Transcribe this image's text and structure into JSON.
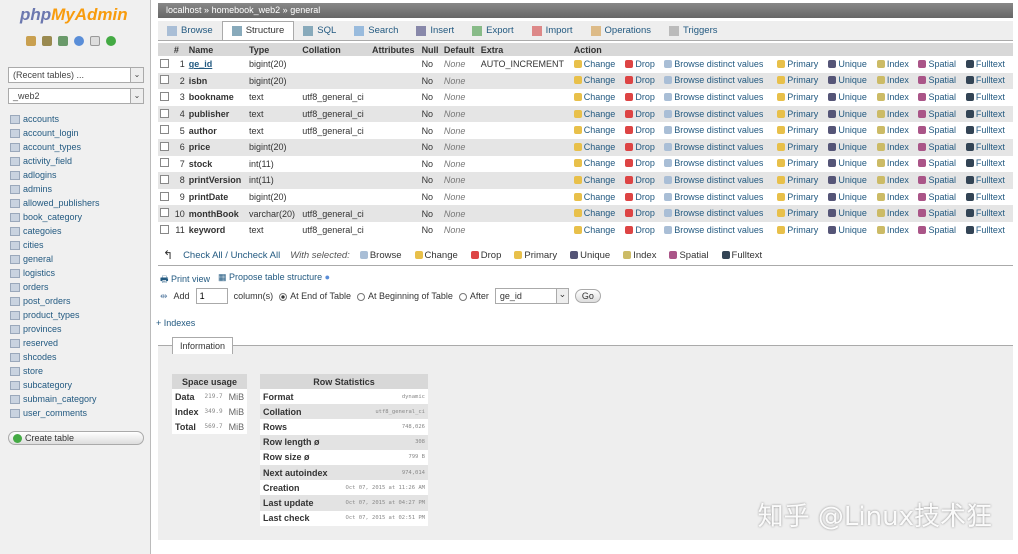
{
  "sidebar": {
    "logo": "phpMyAdmin",
    "logo_php": "php",
    "logo_ma": "MyAdmin",
    "recent_tables": "(Recent tables) ...",
    "database": "_web2",
    "tables": [
      "accounts",
      "account_login",
      "account_types",
      "activity_field",
      "adlogins",
      "admins",
      "allowed_publishers",
      "book_category",
      "categoies",
      "cities",
      "general",
      "logistics",
      "orders",
      "post_orders",
      "product_types",
      "provinces",
      "reserved",
      "shcodes",
      "store",
      "subcategory",
      "submain_category",
      "user_comments"
    ],
    "create_table": "Create table"
  },
  "breadcrumb": {
    "server": "localhost",
    "db": "homebook_web2",
    "table": "general",
    "sep": "»"
  },
  "tabs": [
    "Browse",
    "Structure",
    "SQL",
    "Search",
    "Insert",
    "Export",
    "Import",
    "Operations",
    "Triggers"
  ],
  "active_tab": "Structure",
  "columns_header": [
    "#",
    "Name",
    "Type",
    "Collation",
    "Attributes",
    "Null",
    "Default",
    "Extra",
    "Action"
  ],
  "actions": [
    "Change",
    "Drop",
    "Browse distinct values",
    "Primary",
    "Unique",
    "Index",
    "Spatial",
    "Fulltext"
  ],
  "rows": [
    {
      "n": "1",
      "name": "ge_id",
      "type": "bigint(20)",
      "collation": "",
      "null": "No",
      "default": "None",
      "extra": "AUTO_INCREMENT"
    },
    {
      "n": "2",
      "name": "isbn",
      "type": "bigint(20)",
      "collation": "",
      "null": "No",
      "default": "None",
      "extra": ""
    },
    {
      "n": "3",
      "name": "bookname",
      "type": "text",
      "collation": "utf8_general_ci",
      "null": "No",
      "default": "None",
      "extra": ""
    },
    {
      "n": "4",
      "name": "publisher",
      "type": "text",
      "collation": "utf8_general_ci",
      "null": "No",
      "default": "None",
      "extra": ""
    },
    {
      "n": "5",
      "name": "author",
      "type": "text",
      "collation": "utf8_general_ci",
      "null": "No",
      "default": "None",
      "extra": ""
    },
    {
      "n": "6",
      "name": "price",
      "type": "bigint(20)",
      "collation": "",
      "null": "No",
      "default": "None",
      "extra": ""
    },
    {
      "n": "7",
      "name": "stock",
      "type": "int(11)",
      "collation": "",
      "null": "No",
      "default": "None",
      "extra": ""
    },
    {
      "n": "8",
      "name": "printVersion",
      "type": "int(11)",
      "collation": "",
      "null": "No",
      "default": "None",
      "extra": ""
    },
    {
      "n": "9",
      "name": "printDate",
      "type": "bigint(20)",
      "collation": "",
      "null": "No",
      "default": "None",
      "extra": ""
    },
    {
      "n": "10",
      "name": "monthBook",
      "type": "varchar(20)",
      "collation": "utf8_general_ci",
      "null": "No",
      "default": "None",
      "extra": ""
    },
    {
      "n": "11",
      "name": "keyword",
      "type": "text",
      "collation": "utf8_general_ci",
      "null": "No",
      "default": "None",
      "extra": ""
    }
  ],
  "with_selected": {
    "check_all": "Check All / Uncheck All",
    "label": "With selected:",
    "actions": [
      "Browse",
      "Change",
      "Drop",
      "Primary",
      "Unique",
      "Index",
      "Spatial",
      "Fulltext"
    ]
  },
  "tools": {
    "print_view": "Print view",
    "propose": "Propose table structure"
  },
  "add_column": {
    "label": "Add",
    "count": "1",
    "suffix": "column(s)",
    "at_end": "At End of Table",
    "at_begin": "At Beginning of Table",
    "after": "After",
    "after_value": "ge_id",
    "go": "Go"
  },
  "indexes_link": "+ Indexes",
  "information": {
    "tab": "Information",
    "space_usage": {
      "title": "Space usage",
      "rows": [
        {
          "label": "Data",
          "value": "219.7",
          "unit": "MiB"
        },
        {
          "label": "Index",
          "value": "349.9",
          "unit": "MiB"
        },
        {
          "label": "Total",
          "value": "569.7",
          "unit": "MiB"
        }
      ]
    },
    "row_stats": {
      "title": "Row Statistics",
      "rows": [
        {
          "label": "Format",
          "value": "dynamic"
        },
        {
          "label": "Collation",
          "value": "utf8_general_ci"
        },
        {
          "label": "Rows",
          "value": "748,026"
        },
        {
          "label": "Row length ø",
          "value": "308"
        },
        {
          "label": "Row size ø",
          "value": "799 B"
        },
        {
          "label": "Next autoindex",
          "value": "974,014"
        },
        {
          "label": "Creation",
          "value": "Oct 07, 2015 at 11:26 AM"
        },
        {
          "label": "Last update",
          "value": "Oct 07, 2015 at 04:27 PM"
        },
        {
          "label": "Last check",
          "value": "Oct 07, 2015 at 02:51 PM"
        }
      ]
    }
  },
  "watermark": "知乎 @Linux技术狂",
  "colors": {
    "link": "#235a81",
    "logo_php": "#6c78af",
    "logo_ma": "#f89c0e",
    "row_alt": "#e5e5e5"
  }
}
